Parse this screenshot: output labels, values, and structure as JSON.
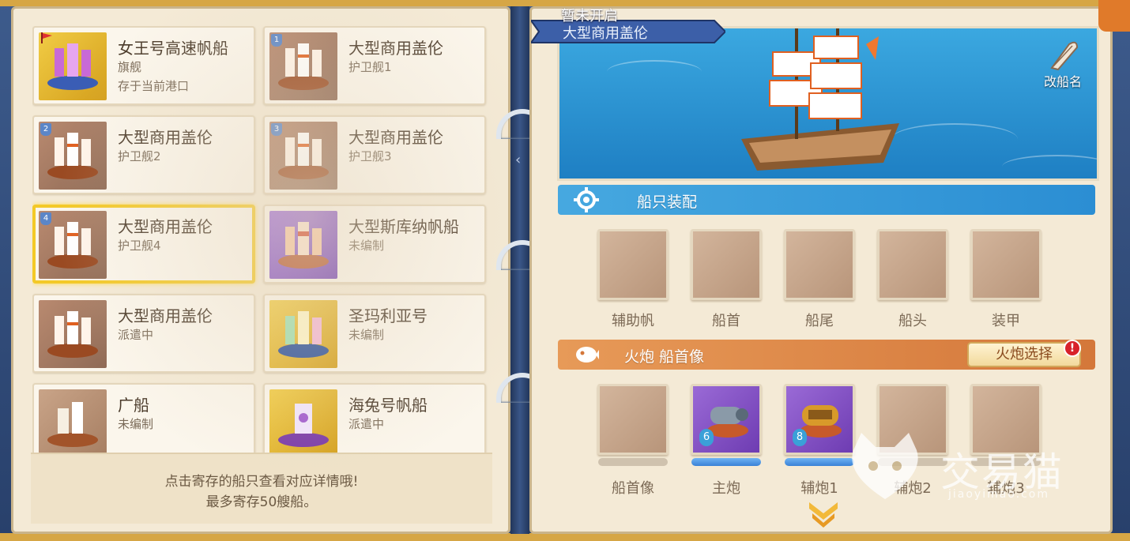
{
  "ship_list": [
    {
      "name": "女王号高速帆船",
      "status": "旗舰",
      "status2": "存于当前港口",
      "thumb": "gold",
      "badge": "flag",
      "selected": false
    },
    {
      "name": "大型商用盖伦",
      "status": "护卫舰1",
      "status2": "",
      "thumb": "brown",
      "badge": "1",
      "selected": false
    },
    {
      "name": "大型商用盖伦",
      "status": "护卫舰2",
      "status2": "",
      "thumb": "brown",
      "badge": "2",
      "selected": false
    },
    {
      "name": "大型商用盖伦",
      "status": "护卫舰3",
      "status2": "",
      "thumb": "brown",
      "badge": "3",
      "selected": false
    },
    {
      "name": "大型商用盖伦",
      "status": "护卫舰4",
      "status2": "",
      "thumb": "brown",
      "badge": "4",
      "selected": true
    },
    {
      "name": "大型斯库纳帆船",
      "status": "未编制",
      "status2": "",
      "thumb": "purple",
      "badge": "",
      "selected": false
    },
    {
      "name": "大型商用盖伦",
      "status": "派遣中",
      "status2": "",
      "thumb": "brown",
      "badge": "",
      "selected": false
    },
    {
      "name": "圣玛利亚号",
      "status": "未编制",
      "status2": "",
      "thumb": "gold",
      "badge": "",
      "selected": false
    },
    {
      "name": "广船",
      "status": "未编制",
      "status2": "",
      "thumb": "tan",
      "badge": "",
      "selected": false
    },
    {
      "name": "海兔号帆船",
      "status": "派遣中",
      "status2": "",
      "thumb": "gold",
      "badge": "",
      "selected": false
    }
  ],
  "tip": {
    "line1": "点击寄存的船只查看对应详情哦!",
    "line2": "最多寄存50艘船。"
  },
  "header": {
    "locked_text": "暂未开启",
    "ship_name": "大型商用盖伦",
    "rename_label": "改船名"
  },
  "equipment": {
    "title": "船只装配",
    "slots": [
      "辅助帆",
      "船首",
      "船尾",
      "船头",
      "装甲"
    ]
  },
  "cannons": {
    "title": "火炮 船首像",
    "select_label": "火炮选择",
    "alert": "!",
    "slots": [
      {
        "label": "船首像",
        "level": ""
      },
      {
        "label": "主炮",
        "level": "6"
      },
      {
        "label": "辅炮1",
        "level": "8"
      },
      {
        "label": "辅炮2",
        "level": ""
      },
      {
        "label": "辅炮3",
        "level": ""
      }
    ]
  },
  "watermark": {
    "text": "交易猫",
    "sub": "jiaoyimao.com"
  },
  "colors": {
    "accent_blue": "#2b8ed3",
    "accent_orange": "#d4773a",
    "selected_gold": "#f3c928",
    "alert_red": "#d8222a"
  },
  "icons": [
    "gear-icon",
    "fish-icon",
    "quill-icon",
    "chevron-down-icon",
    "ring-binder-icon",
    "chevron-left-icon",
    "flag-icon"
  ]
}
